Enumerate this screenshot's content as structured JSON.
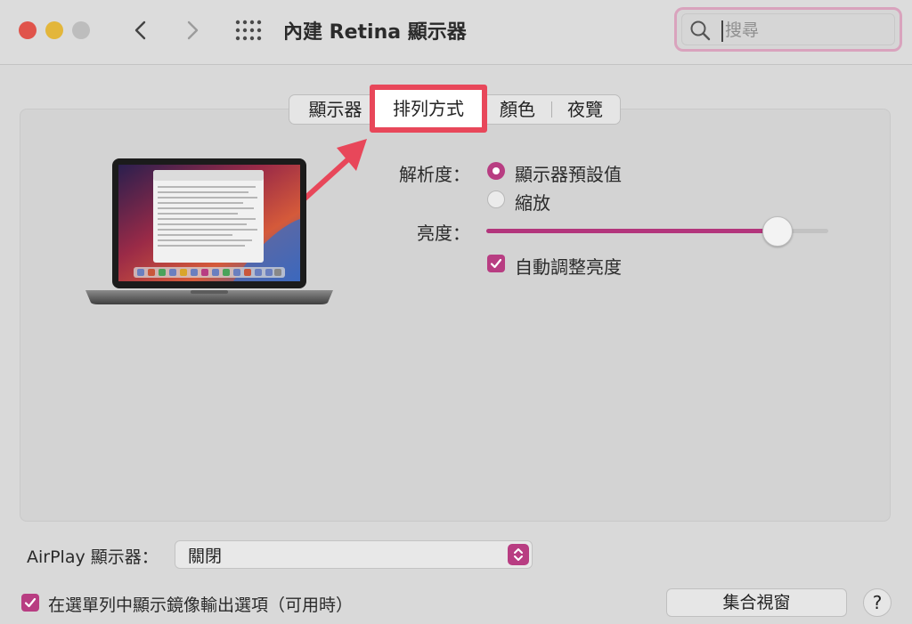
{
  "window": {
    "title": "內建 Retina 顯示器",
    "search": {
      "placeholder": "搜尋",
      "value": ""
    }
  },
  "toolbar": {
    "back_icon": "chevron-left-icon",
    "forward_icon": "chevron-right-icon",
    "grid_icon": "show-all-grid-icon"
  },
  "tabs": [
    {
      "label": "顯示器",
      "selected": false
    },
    {
      "label": "排列方式",
      "selected": true
    },
    {
      "label": "顏色",
      "selected": false
    },
    {
      "label": "夜覽",
      "selected": false
    }
  ],
  "display": {
    "resolution_label": "解析度：",
    "resolution_options": [
      {
        "label": "顯示器預設值",
        "selected": true
      },
      {
        "label": "縮放",
        "selected": false
      }
    ],
    "brightness_label": "亮度：",
    "brightness_value": 0.85,
    "auto_brightness_label": "自動調整亮度",
    "auto_brightness_checked": true
  },
  "bottom": {
    "airplay_label": "AirPlay 顯示器：",
    "airplay_value": "關閉",
    "mirror_option_label": "在選單列中顯示鏡像輸出選項（可用時）",
    "mirror_option_checked": true,
    "gather_button_label": "集合視窗",
    "help_label": "?"
  },
  "colors": {
    "accent": "#b83d82",
    "highlight": "#e8475a"
  }
}
